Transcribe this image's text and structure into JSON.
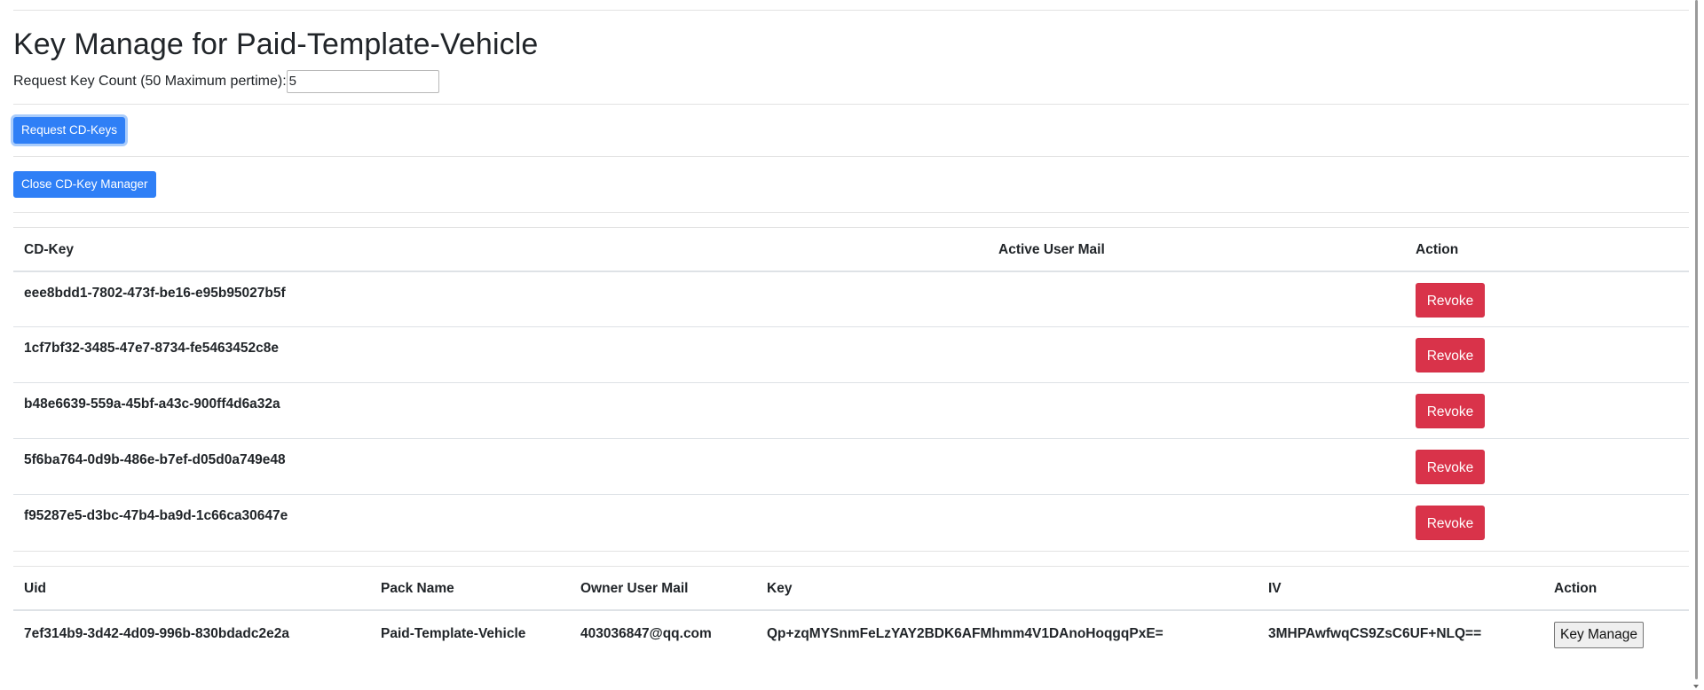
{
  "header": {
    "title": "Key Manage for Paid-Template-Vehicle",
    "request_label": "Request Key Count (50 Maximum pertime):",
    "request_value": "5"
  },
  "buttons": {
    "request_keys": "Request CD-Keys",
    "close_manager": "Close CD-Key Manager"
  },
  "keys_table": {
    "columns": [
      "CD-Key",
      "Active User Mail",
      "Action"
    ],
    "rows": [
      {
        "key": "eee8bdd1-7802-473f-be16-e95b95027b5f",
        "mail": "",
        "action": "Revoke"
      },
      {
        "key": "1cf7bf32-3485-47e7-8734-fe5463452c8e",
        "mail": "",
        "action": "Revoke"
      },
      {
        "key": "b48e6639-559a-45bf-a43c-900ff4d6a32a",
        "mail": "",
        "action": "Revoke"
      },
      {
        "key": "5f6ba764-0d9b-486e-b7ef-d05d0a749e48",
        "mail": "",
        "action": "Revoke"
      },
      {
        "key": "f95287e5-d3bc-47b4-ba9d-1c66ca30647e",
        "mail": "",
        "action": "Revoke"
      }
    ]
  },
  "packs_table": {
    "columns": [
      "Uid",
      "Pack Name",
      "Owner User Mail",
      "Key",
      "IV",
      "Action"
    ],
    "rows": [
      {
        "uid": "7ef314b9-3d42-4d09-996b-830bdadc2e2a",
        "pack_name": "Paid-Template-Vehicle",
        "owner_mail": "403036847@qq.com",
        "key": "Qp+zqMYSnmFeLzYAY2BDK6AFMhmm4V1DAnoHoqgqPxE=",
        "iv": "3MHPAwfwqCS9ZsC6UF+NLQ==",
        "action": "Key Manage"
      }
    ]
  },
  "colors": {
    "primary": "#2f7ff6",
    "danger": "#d9334a",
    "divider": "#dee2e6"
  }
}
